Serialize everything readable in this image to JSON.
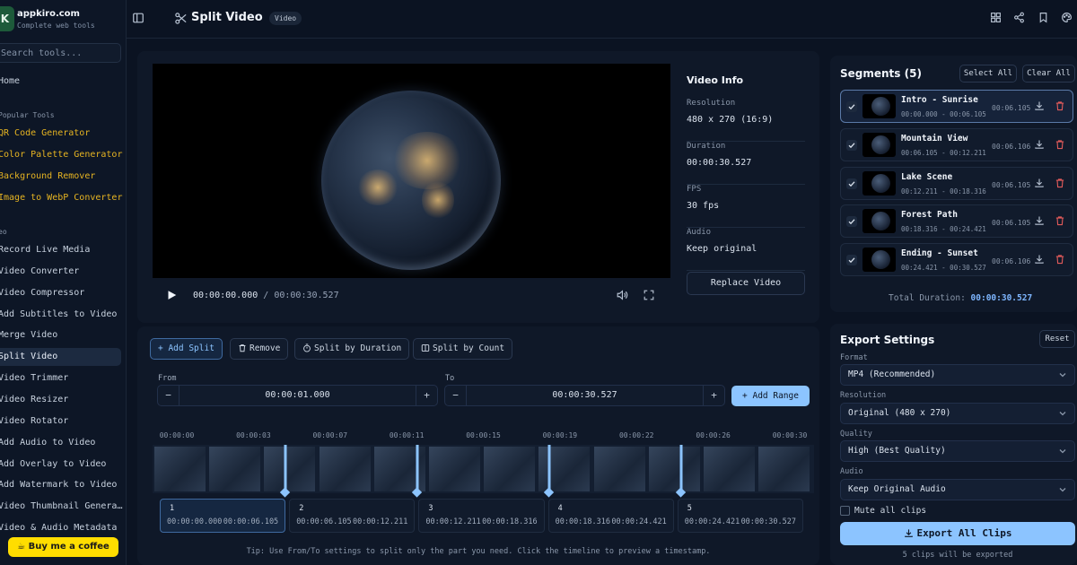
{
  "sidebar": {
    "logo_letter": "K",
    "brand_name": "appkiro.com",
    "brand_tagline": "Complete web tools",
    "search_placeholder": "Search tools...",
    "home": "Home",
    "popular_heading": "Popular Tools",
    "popular": [
      "QR Code Generator",
      "Color Palette Generator",
      "Background Remover",
      "Image to WebP Converter"
    ],
    "section_heading": "eo",
    "items": [
      "Record Live Media",
      "Video Converter",
      "Video Compressor",
      "Add Subtitles to Video",
      "Merge Video",
      "Split Video",
      "Video Trimmer",
      "Video Resizer",
      "Video Rotator",
      "Add Audio to Video",
      "Add Overlay to Video",
      "Add Watermark to Video",
      "Video Thumbnail Genera…",
      "Video & Audio Metadata"
    ],
    "active_index": 5,
    "coffee_label": "Buy me a coffee"
  },
  "header": {
    "title": "Split Video",
    "badge": "Video"
  },
  "player": {
    "current": "00:00:00.000",
    "separator": "/",
    "duration": "00:00:30.527"
  },
  "info": {
    "title": "Video Info",
    "rows": [
      {
        "label": "Resolution",
        "value": "480 x 270 (16:9)"
      },
      {
        "label": "Duration",
        "value": "00:00:30.527"
      },
      {
        "label": "FPS",
        "value": "30 fps"
      },
      {
        "label": "Audio",
        "value": "Keep original"
      }
    ],
    "replace_label": "Replace Video"
  },
  "segments": {
    "title": "Segments (5)",
    "select_all": "Select All",
    "clear_all": "Clear All",
    "items": [
      {
        "name": "Intro - Sunrise",
        "range": "00:00.000 - 00:06.105",
        "duration": "00:06.105"
      },
      {
        "name": "Mountain View",
        "range": "00:06.105 - 00:12.211",
        "duration": "00:06.106"
      },
      {
        "name": "Lake Scene",
        "range": "00:12.211 - 00:18.316",
        "duration": "00:06.105"
      },
      {
        "name": "Forest Path",
        "range": "00:18.316 - 00:24.421",
        "duration": "00:06.105"
      },
      {
        "name": "Ending - Sunset",
        "range": "00:24.421 - 00:30.527",
        "duration": "00:06.106"
      }
    ],
    "total_label": "Total Duration:",
    "total_value": "00:00:30.527"
  },
  "export": {
    "title": "Export Settings",
    "reset": "Reset",
    "format_label": "Format",
    "format_value": "MP4 (Recommended)",
    "resolution_label": "Resolution",
    "resolution_value": "Original (480 x 270)",
    "quality_label": "Quality",
    "quality_value": "High (Best Quality)",
    "audio_label": "Audio",
    "audio_value": "Keep Original Audio",
    "mute_label": "Mute all clips",
    "mute_checked": false,
    "export_label": "Export All Clips",
    "note": "5 clips will be exported"
  },
  "tools": {
    "add_split": "Add Split",
    "remove": "Remove",
    "split_duration": "Split by Duration",
    "split_count": "Split by Count",
    "from_label": "From",
    "from_value": "00:00:01.000",
    "to_label": "To",
    "to_value": "00:00:30.527",
    "add_range": "Add Range"
  },
  "timeline": {
    "duration_seconds": 30.527,
    "ticks": [
      {
        "label": "00:00:00",
        "seconds": 0
      },
      {
        "label": "00:00:03",
        "seconds": 3.816
      },
      {
        "label": "00:00:07",
        "seconds": 7.632
      },
      {
        "label": "00:00:11",
        "seconds": 11.448
      },
      {
        "label": "00:00:15",
        "seconds": 15.264
      },
      {
        "label": "00:00:19",
        "seconds": 19.079
      },
      {
        "label": "00:00:22",
        "seconds": 22.895
      },
      {
        "label": "00:00:26",
        "seconds": 26.711
      },
      {
        "label": "00:00:30",
        "seconds": 30.527
      }
    ],
    "split_points": [
      6.105,
      12.211,
      18.316,
      24.421
    ],
    "cells": [
      {
        "index": "1",
        "start": "00:00:00.000",
        "end": "00:00:06.105"
      },
      {
        "index": "2",
        "start": "00:00:06.105",
        "end": "00:00:12.211"
      },
      {
        "index": "3",
        "start": "00:00:12.211",
        "end": "00:00:18.316"
      },
      {
        "index": "4",
        "start": "00:00:18.316",
        "end": "00:00:24.421"
      },
      {
        "index": "5",
        "start": "00:00:24.421",
        "end": "00:00:30.527"
      }
    ],
    "selected_cell": 0,
    "tip": "Tip: Use From/To settings to split only the part you need. Click the timeline to preview a timestamp."
  },
  "colors": {
    "accent": "#8cc4ff",
    "popular": "#e6b422",
    "danger": "#e05a5a",
    "coffee": "#ffdd00"
  }
}
